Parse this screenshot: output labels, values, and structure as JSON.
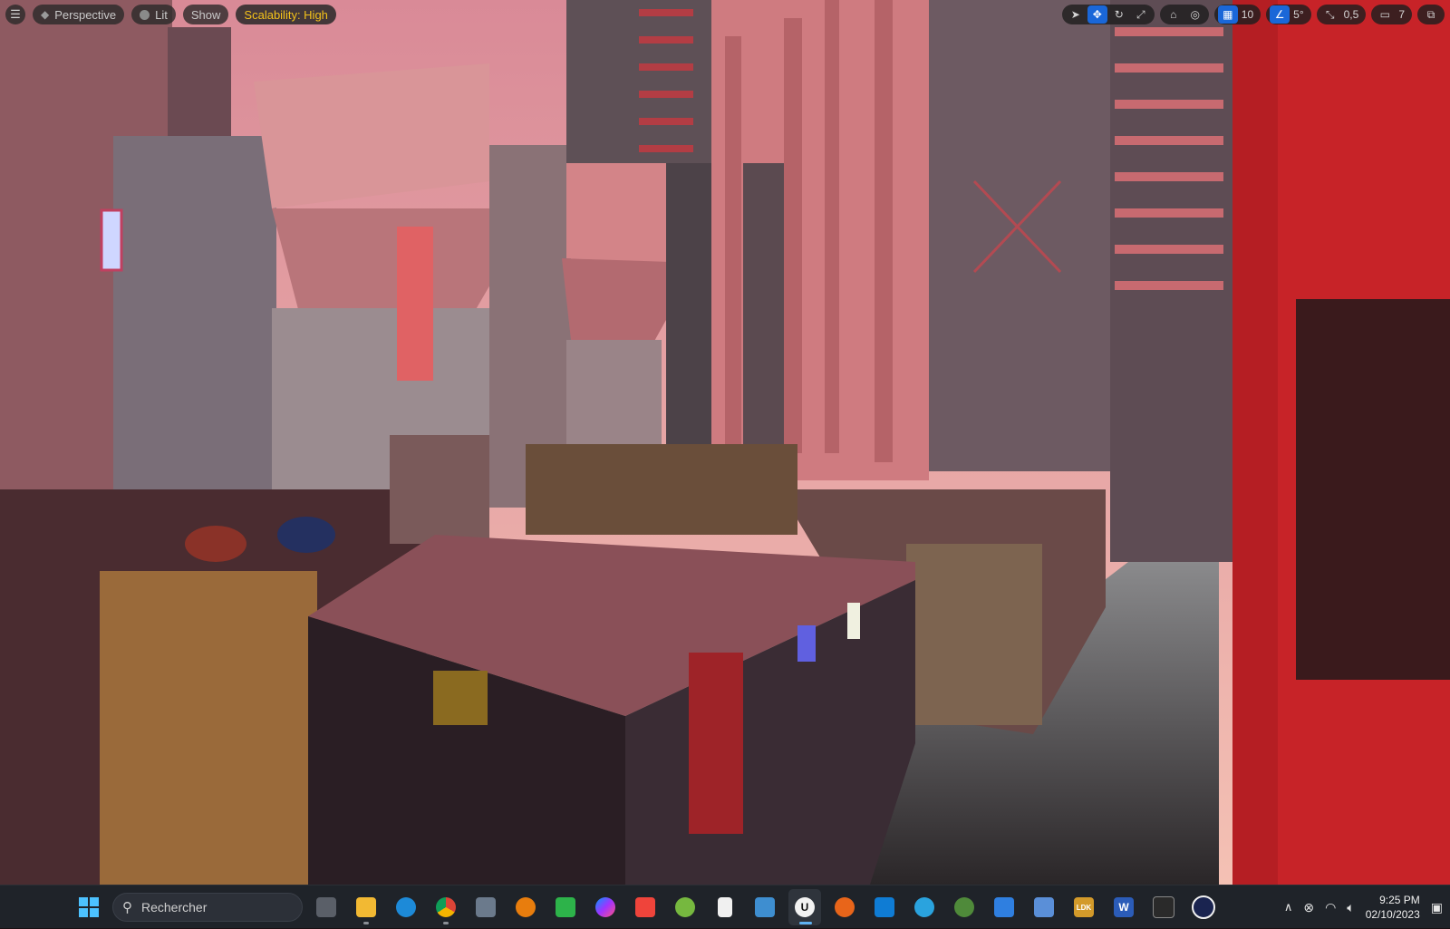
{
  "viewport": {
    "toolbar_left": {
      "view_mode": "Perspective",
      "lighting": "Lit",
      "show": "Show",
      "scalability": "Scalability: High"
    },
    "toolbar_right": {
      "grid_snap": "10",
      "rotation_snap": "5°",
      "scale_snap": "0,5",
      "camera_speed": "7"
    },
    "colors": {
      "accent": "#1a67d8",
      "scalability_text": "#f3c21a",
      "sky_top": "#e58c94",
      "sky_bottom": "#f2b3a8"
    }
  },
  "taskbar": {
    "search_placeholder": "Rechercher",
    "apps": [
      {
        "name": "task-view",
        "icon": "task-view-icon"
      },
      {
        "name": "file-explorer",
        "icon": "folder-icon"
      },
      {
        "name": "edge",
        "icon": "edge-icon"
      },
      {
        "name": "chrome",
        "icon": "chrome-icon"
      },
      {
        "name": "calculator",
        "icon": "calculator-icon"
      },
      {
        "name": "blender",
        "icon": "blender-icon"
      },
      {
        "name": "app-green",
        "icon": "green-app-icon"
      },
      {
        "name": "messenger",
        "icon": "messenger-icon"
      },
      {
        "name": "anydesk",
        "icon": "anydesk-icon"
      },
      {
        "name": "utorrent",
        "icon": "utorrent-icon"
      },
      {
        "name": "file",
        "icon": "document-icon"
      },
      {
        "name": "control-panel",
        "icon": "control-panel-icon"
      },
      {
        "name": "unreal-engine",
        "icon": "unreal-icon"
      },
      {
        "name": "app-orange",
        "icon": "orange-spiral-icon"
      },
      {
        "name": "vscode",
        "icon": "vscode-icon"
      },
      {
        "name": "telegram",
        "icon": "telegram-icon"
      },
      {
        "name": "tree-app",
        "icon": "tree-icon"
      },
      {
        "name": "app-blue",
        "icon": "blue-app-icon"
      },
      {
        "name": "app-robot",
        "icon": "robot-icon"
      },
      {
        "name": "app-ldk",
        "icon": "ldk-icon"
      },
      {
        "name": "word",
        "icon": "word-icon"
      },
      {
        "name": "terminal",
        "icon": "terminal-icon"
      },
      {
        "name": "app-dark",
        "icon": "dark-circle-icon"
      }
    ],
    "ldk_label": "LDK",
    "word_label": "W",
    "unreal_label": "U",
    "time": "9:25 PM",
    "date": "02/10/2023"
  }
}
